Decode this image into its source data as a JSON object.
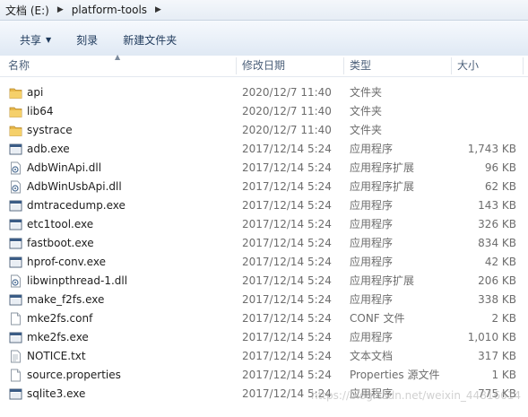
{
  "breadcrumb": {
    "items": [
      "文档 (E:)",
      "platform-tools"
    ]
  },
  "toolbar": {
    "share_label": "共享",
    "burn_label": "刻录",
    "new_folder_label": "新建文件夹"
  },
  "columns": {
    "name": "名称",
    "modified": "修改日期",
    "type": "类型",
    "size": "大小"
  },
  "files": [
    {
      "name": "api",
      "date": "2020/12/7 11:40",
      "type": "文件夹",
      "size": "",
      "icon": "folder-icon"
    },
    {
      "name": "lib64",
      "date": "2020/12/7 11:40",
      "type": "文件夹",
      "size": "",
      "icon": "folder-icon"
    },
    {
      "name": "systrace",
      "date": "2020/12/7 11:40",
      "type": "文件夹",
      "size": "",
      "icon": "folder-icon"
    },
    {
      "name": "adb.exe",
      "date": "2017/12/14 5:24",
      "type": "应用程序",
      "size": "1,743 KB",
      "icon": "exe-icon"
    },
    {
      "name": "AdbWinApi.dll",
      "date": "2017/12/14 5:24",
      "type": "应用程序扩展",
      "size": "96 KB",
      "icon": "dll-icon"
    },
    {
      "name": "AdbWinUsbApi.dll",
      "date": "2017/12/14 5:24",
      "type": "应用程序扩展",
      "size": "62 KB",
      "icon": "dll-icon"
    },
    {
      "name": "dmtracedump.exe",
      "date": "2017/12/14 5:24",
      "type": "应用程序",
      "size": "143 KB",
      "icon": "exe-icon"
    },
    {
      "name": "etc1tool.exe",
      "date": "2017/12/14 5:24",
      "type": "应用程序",
      "size": "326 KB",
      "icon": "exe-icon"
    },
    {
      "name": "fastboot.exe",
      "date": "2017/12/14 5:24",
      "type": "应用程序",
      "size": "834 KB",
      "icon": "exe-icon"
    },
    {
      "name": "hprof-conv.exe",
      "date": "2017/12/14 5:24",
      "type": "应用程序",
      "size": "42 KB",
      "icon": "exe-icon"
    },
    {
      "name": "libwinpthread-1.dll",
      "date": "2017/12/14 5:24",
      "type": "应用程序扩展",
      "size": "206 KB",
      "icon": "dll-icon"
    },
    {
      "name": "make_f2fs.exe",
      "date": "2017/12/14 5:24",
      "type": "应用程序",
      "size": "338 KB",
      "icon": "exe-icon"
    },
    {
      "name": "mke2fs.conf",
      "date": "2017/12/14 5:24",
      "type": "CONF 文件",
      "size": "2 KB",
      "icon": "file-icon"
    },
    {
      "name": "mke2fs.exe",
      "date": "2017/12/14 5:24",
      "type": "应用程序",
      "size": "1,010 KB",
      "icon": "exe-icon"
    },
    {
      "name": "NOTICE.txt",
      "date": "2017/12/14 5:24",
      "type": "文本文档",
      "size": "317 KB",
      "icon": "text-file-icon"
    },
    {
      "name": "source.properties",
      "date": "2017/12/14 5:24",
      "type": "Properties 源文件",
      "size": "1 KB",
      "icon": "file-icon"
    },
    {
      "name": "sqlite3.exe",
      "date": "2017/12/14 5:24",
      "type": "应用程序",
      "size": "775 KB",
      "icon": "exe-icon"
    }
  ],
  "watermark": "https://blog.csdn.net/weixin_44816614"
}
